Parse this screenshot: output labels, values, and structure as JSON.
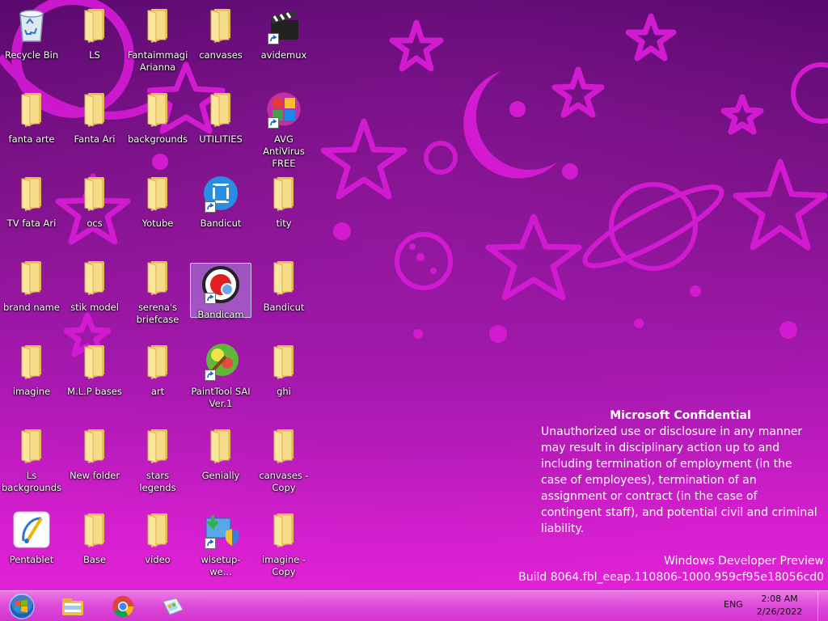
{
  "desktop": {
    "icons": [
      {
        "label": "Recycle Bin",
        "type": "recycle-bin"
      },
      {
        "label": "LS",
        "type": "folder"
      },
      {
        "label": "Fantaimmagi Arianna",
        "type": "folder"
      },
      {
        "label": "canvases",
        "type": "folder"
      },
      {
        "label": "avidemux",
        "type": "avidemux",
        "shortcut": true
      },
      {
        "label": "fanta arte",
        "type": "folder"
      },
      {
        "label": "Fanta Ari",
        "type": "folder"
      },
      {
        "label": "backgrounds",
        "type": "folder"
      },
      {
        "label": "UTILITIES",
        "type": "folder"
      },
      {
        "label": "AVG AntiVirus FREE",
        "type": "avg",
        "shortcut": true
      },
      {
        "label": "TV fata Ari",
        "type": "folder"
      },
      {
        "label": "ocs",
        "type": "folder"
      },
      {
        "label": "Yotube",
        "type": "folder"
      },
      {
        "label": "Bandicut",
        "type": "bandicut",
        "shortcut": true
      },
      {
        "label": "tity",
        "type": "folder"
      },
      {
        "label": "brand name",
        "type": "folder"
      },
      {
        "label": "stik model",
        "type": "folder"
      },
      {
        "label": "serena's briefcase",
        "type": "folder"
      },
      {
        "label": "Bandicam",
        "type": "bandicam",
        "shortcut": true,
        "selected": true
      },
      {
        "label": "Bandicut",
        "type": "folder"
      },
      {
        "label": "imagine",
        "type": "folder"
      },
      {
        "label": "M.L.P bases",
        "type": "folder"
      },
      {
        "label": "art",
        "type": "folder"
      },
      {
        "label": "PaintTool SAI Ver.1",
        "type": "sai",
        "shortcut": true
      },
      {
        "label": "ghi",
        "type": "folder"
      },
      {
        "label": "Ls backgrounds",
        "type": "folder"
      },
      {
        "label": "New folder",
        "type": "folder"
      },
      {
        "label": "stars legends",
        "type": "folder"
      },
      {
        "label": "Genially",
        "type": "folder"
      },
      {
        "label": "canvases - Copy",
        "type": "folder"
      },
      {
        "label": "Pentablet",
        "type": "pentablet"
      },
      {
        "label": "Base",
        "type": "folder"
      },
      {
        "label": "video",
        "type": "folder"
      },
      {
        "label": "wlsetup-we...",
        "type": "wlsetup",
        "shortcut": true
      },
      {
        "label": "imagine - Copy",
        "type": "folder"
      }
    ]
  },
  "watermark": {
    "title": "Microsoft Confidential",
    "body": "Unauthorized use or disclosure in any manner may result in disciplinary action up to and including termination of employment (in the case of employees), termination of an assignment or contract (in the case of contingent staff), and potential civil and criminal liability.",
    "edition": "Windows Developer Preview",
    "build": "Build 8064.fbl_eeap.110806-1000.959cf95e18056cd0"
  },
  "taskbar": {
    "pinned": [
      {
        "name": "start-button",
        "icon": "windows-orb-icon"
      },
      {
        "name": "file-explorer-button",
        "icon": "libraries-folder-icon"
      },
      {
        "name": "chrome-button",
        "icon": "chrome-icon"
      },
      {
        "name": "paint-app-button",
        "icon": "paint-icon"
      }
    ],
    "language": "ENG",
    "time": "2:08 AM",
    "date": "2/26/2022"
  },
  "colors": {
    "wallpaper_top": "#5a0a6e",
    "wallpaper_bottom": "#e424d8",
    "star_outline": "#d21ad0",
    "folder": "#f4d77a"
  }
}
